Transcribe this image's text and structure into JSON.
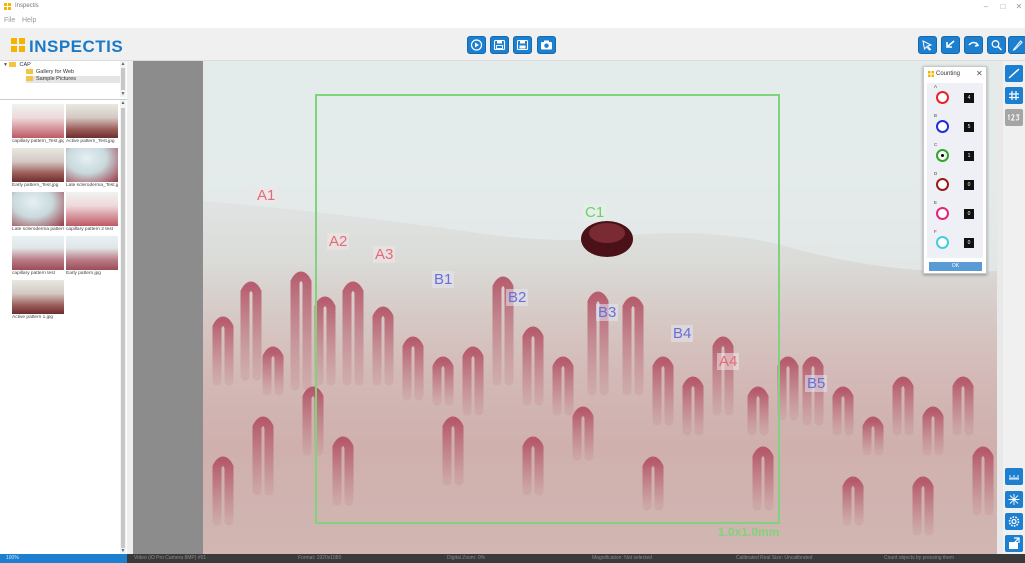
{
  "window": {
    "title": "Inspectis",
    "controls": {
      "minimize": "–",
      "maximize": "□",
      "close": "✕"
    }
  },
  "menu": {
    "items": [
      "File",
      "Help"
    ]
  },
  "app": {
    "brand": "INSPECTIS",
    "brand_color": "#1a7ac8",
    "accent": "#1c7fcf"
  },
  "toolbar": {
    "center": [
      "play-icon",
      "capture-sequence-icon",
      "save-icon",
      "camera-icon"
    ],
    "right": [
      "select-arrow-icon",
      "undo-icon",
      "redo-icon",
      "search-icon",
      "pen-icon"
    ]
  },
  "tree": {
    "root": "CAP",
    "children": [
      "Gallery for Web",
      "Sample Pictures"
    ]
  },
  "thumbnails": [
    {
      "caption": "capillary pattern_Test.jpg",
      "style": "v4"
    },
    {
      "caption": "Active pattern_Test.jpg",
      "style": "v2"
    },
    {
      "caption": "Early pattern_Test.jpg",
      "style": "v2"
    },
    {
      "caption": "Late scleroderma_Test.jpg",
      "style": "v3"
    },
    {
      "caption": "Late scleroderma pattern 3...",
      "style": "v3"
    },
    {
      "caption": "capillary pattern 2 test",
      "style": "v4"
    },
    {
      "caption": "capillary pattern test",
      "style": "v5"
    },
    {
      "caption": "Early pattern.jpg",
      "style": "v5"
    },
    {
      "caption": "Active pattern 1.jpg",
      "style": "v2"
    }
  ],
  "viewer": {
    "roi_label": "1.0x1.0mm",
    "roi_color": "#7ed37c",
    "marks": [
      {
        "text": "A1",
        "group": "a"
      },
      {
        "text": "A2",
        "group": "a"
      },
      {
        "text": "A3",
        "group": "a"
      },
      {
        "text": "A4",
        "group": "a"
      },
      {
        "text": "B1",
        "group": "b"
      },
      {
        "text": "B2",
        "group": "b"
      },
      {
        "text": "B3",
        "group": "b"
      },
      {
        "text": "B4",
        "group": "b"
      },
      {
        "text": "B5",
        "group": "b"
      },
      {
        "text": "C1",
        "group": "c"
      }
    ]
  },
  "counting": {
    "title": "Counting",
    "close": "✕",
    "ok_label": "OK",
    "rows": [
      {
        "label": "A",
        "color": "#e8212f",
        "count": "4",
        "active": false
      },
      {
        "label": "B",
        "color": "#1f2fd6",
        "count": "5",
        "active": false
      },
      {
        "label": "C",
        "color": "#2ea82a",
        "count": "1",
        "active": true
      },
      {
        "label": "D",
        "color": "#9b1a1a",
        "count": "0",
        "active": false
      },
      {
        "label": "E",
        "color": "#e6237d",
        "count": "0",
        "active": false
      },
      {
        "label": "F",
        "color": "#3fd0df",
        "count": "0",
        "active": false
      }
    ]
  },
  "rightbar": {
    "top": [
      "line-tool-icon",
      "grid-icon",
      "numbering-icon"
    ],
    "bottom": [
      "ruler-icon",
      "brightness-icon",
      "settings-icon",
      "export-icon"
    ]
  },
  "status": {
    "zoom": "100%",
    "camera": "Video (iO Pro Camera 8MP) #01",
    "format": "Format: 1920x1080",
    "digital_zoom": "Digital Zoom: 0%",
    "magnification": "Magnification: Not selected",
    "calibrated": "Calibrated Real Size: Uncalibrated",
    "hint": "Count objects by pressing them"
  }
}
